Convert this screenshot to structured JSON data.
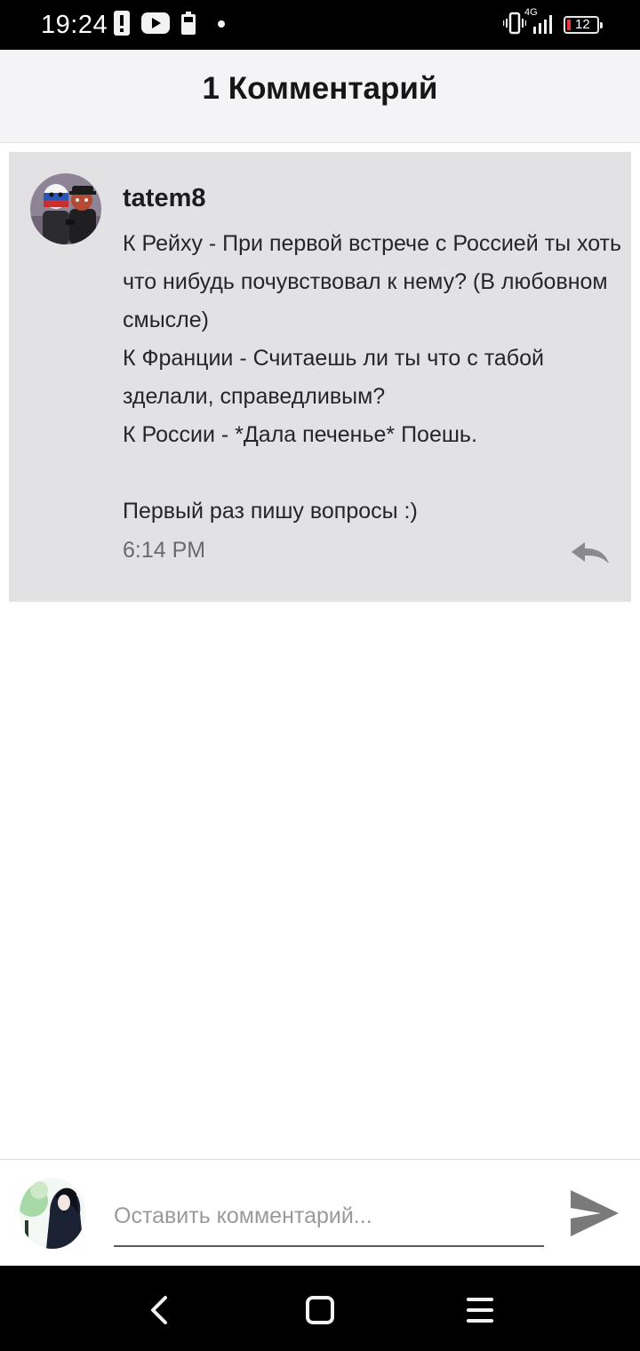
{
  "status_bar": {
    "time": "19:24",
    "network": "4G",
    "battery": "12",
    "icons": [
      "alert-icon",
      "youtube-icon",
      "battery-saver-icon",
      "dot-icon",
      "vibrate-icon",
      "signal-icon",
      "battery-icon"
    ]
  },
  "header": {
    "title": "1 Комментарий"
  },
  "comment": {
    "username": "tatem8",
    "text": "К Рейху - При первой встрече с Россией ты хоть что нибудь почувствовал к нему? (В любовном смысле)\nК Франции - Считаешь ли ты что с табой зделали, справедливым?\nК России - *Дала печенье* Поешь.\n\nПервый раз пишу вопросы :)",
    "time": "6:14 PM"
  },
  "input_bar": {
    "placeholder": "Оставить комментарий...",
    "value": ""
  },
  "colors": {
    "header_bg": "#f4f3f5",
    "card_bg": "#e2e1e4",
    "bar_bg": "#000000",
    "battery_low": "#e53935"
  }
}
